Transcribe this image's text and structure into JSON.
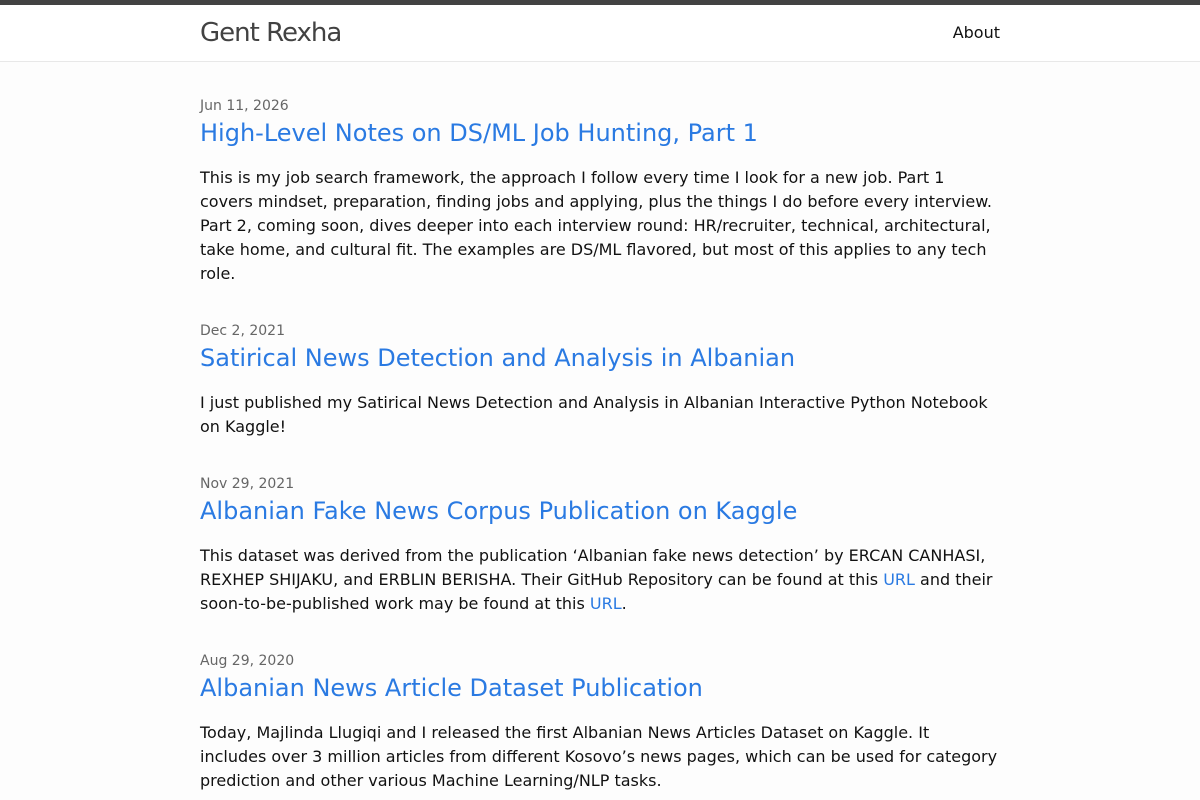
{
  "header": {
    "site_title": "Gent Rexha",
    "nav_about": "About"
  },
  "posts": [
    {
      "date": "Jun 11, 2026",
      "title": "High-Level Notes on DS/ML Job Hunting, Part 1",
      "excerpt": "This is my job search framework, the approach I follow every time I look for a new job. Part 1 covers mindset, preparation, finding jobs and applying, plus the things I do before every interview. Part 2, coming soon, dives deeper into each interview round: HR/recruiter, technical, architectural, take home, and cultural fit. The examples are DS/ML flavored, but most of this applies to any tech role."
    },
    {
      "date": "Dec 2, 2021",
      "title": "Satirical News Detection and Analysis in Albanian",
      "excerpt": "I just published my Satirical News Detection and Analysis in Albanian Interactive Python Notebook on Kaggle!"
    },
    {
      "date": "Nov 29, 2021",
      "title": "Albanian Fake News Corpus Publication on Kaggle",
      "excerpt_part1": "This dataset was derived from the publication ‘Albanian fake news detection’ by ERCAN CANHASI, REXHEP SHIJAKU, and ERBLIN BERISHA. Their GitHub Repository can be found at this ",
      "link1": "URL",
      "excerpt_part2": " and their soon-to-be-published work may be found at this ",
      "link2": "URL",
      "excerpt_part3": "."
    },
    {
      "date": "Aug 29, 2020",
      "title": "Albanian News Article Dataset Publication",
      "excerpt": "Today, Majlinda Llugiqi and I released the first Albanian News Articles Dataset on Kaggle. It includes over 3 million articles from different Kosovo’s news pages, which can be used for category prediction and other various Machine Learning/NLP tasks."
    }
  ],
  "colors": {
    "link": "#2a7ae2",
    "meta": "#666666",
    "topbar": "#424242"
  }
}
